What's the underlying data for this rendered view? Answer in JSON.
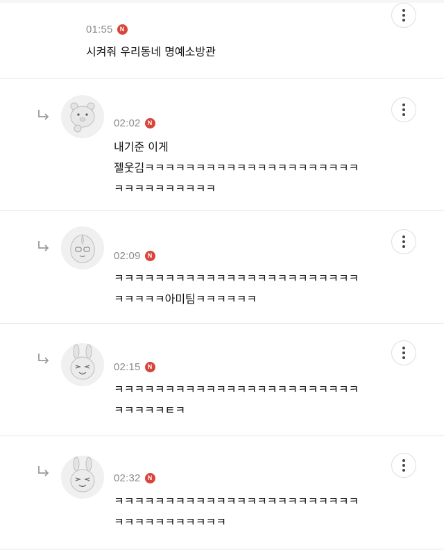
{
  "comments": [
    {
      "time": "01:55",
      "badge": "N",
      "lines": [
        "시켜줘 우리동네 명예소방관"
      ],
      "is_reply": false,
      "icons": {
        "more": "more-vertical-icon"
      }
    },
    {
      "time": "02:02",
      "badge": "N",
      "lines": [
        "내기준 이게",
        "젤웃김ㅋㅋㅋㅋㅋㅋㅋㅋㅋㅋㅋㅋㅋㅋㅋㅋㅋㅋㅋㅋㅋ",
        "ㅋㅋㅋㅋㅋㅋㅋㅋㅋㅋ"
      ],
      "is_reply": true,
      "avatar": "ryan-character-avatar",
      "icons": {
        "reply": "reply-arrow-icon",
        "more": "more-vertical-icon"
      }
    },
    {
      "time": "02:09",
      "badge": "N",
      "lines": [
        "ㅋㅋㅋㅋㅋㅋㅋㅋㅋㅋㅋㅋㅋㅋㅋㅋㅋㅋㅋㅋㅋㅋㅋㅋ",
        "ㅋㅋㅋㅋㅋ아미팀ㅋㅋㅋㅋㅋㅋ"
      ],
      "is_reply": true,
      "avatar": "apeach-character-avatar",
      "icons": {
        "reply": "reply-arrow-icon",
        "more": "more-vertical-icon"
      }
    },
    {
      "time": "02:15",
      "badge": "N",
      "lines": [
        "ㅋㅋㅋㅋㅋㅋㅋㅋㅋㅋㅋㅋㅋㅋㅋㅋㅋㅋㅋㅋㅋㅋㅋㅋ",
        "ㅋㅋㅋㅋㅋㅌㅋ"
      ],
      "is_reply": true,
      "avatar": "muzi-character-avatar",
      "icons": {
        "reply": "reply-arrow-icon",
        "more": "more-vertical-icon"
      }
    },
    {
      "time": "02:32",
      "badge": "N",
      "lines": [
        "ㅋㅋㅋㅋㅋㅋㅋㅋㅋㅋㅋㅋㅋㅋㅋㅋㅋㅋㅋㅋㅋㅋㅋㅋ",
        "ㅋㅋㅋㅋㅋㅋㅋㅋㅋㅋㅋ"
      ],
      "is_reply": true,
      "avatar": "muzi-character-avatar",
      "icons": {
        "reply": "reply-arrow-icon",
        "more": "more-vertical-icon"
      }
    }
  ],
  "colors": {
    "badge": "#d9443b",
    "time": "#8a8a8a",
    "divider": "#e6e6e6",
    "text": "#111111"
  }
}
